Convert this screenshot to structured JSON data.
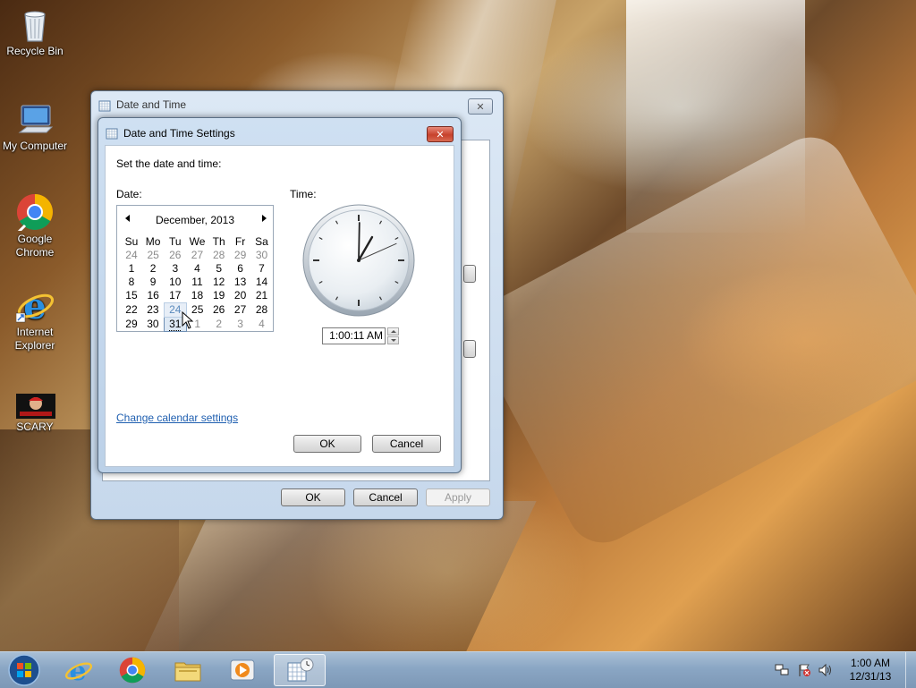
{
  "desktop": {
    "icons": [
      {
        "label": "Recycle Bin"
      },
      {
        "label": "My Computer"
      },
      {
        "label": "Google\nChrome"
      },
      {
        "label": "Internet\nExplorer"
      },
      {
        "label": "SCARY"
      }
    ]
  },
  "outer_window": {
    "title": "Date and Time",
    "ok_label": "OK",
    "cancel_label": "Cancel",
    "apply_label": "Apply"
  },
  "dialog": {
    "title": "Date and Time Settings",
    "instruction": "Set the date and time:",
    "date_label": "Date:",
    "time_label": "Time:",
    "calendar": {
      "month_year": "December, 2013",
      "weekdays": [
        "Su",
        "Mo",
        "Tu",
        "We",
        "Th",
        "Fr",
        "Sa"
      ],
      "weeks": [
        [
          "24",
          "25",
          "26",
          "27",
          "28",
          "29",
          "30"
        ],
        [
          "1",
          "2",
          "3",
          "4",
          "5",
          "6",
          "7"
        ],
        [
          "8",
          "9",
          "10",
          "11",
          "12",
          "13",
          "14"
        ],
        [
          "15",
          "16",
          "17",
          "18",
          "19",
          "20",
          "21"
        ],
        [
          "22",
          "23",
          "24",
          "25",
          "26",
          "27",
          "28"
        ],
        [
          "29",
          "30",
          "31",
          "1",
          "2",
          "3",
          "4"
        ]
      ]
    },
    "time_value": "1:00:11 AM",
    "clock_hour": 1,
    "clock_minute": 0,
    "clock_second": 11,
    "change_calendar_link": "Change calendar settings",
    "ok_label": "OK",
    "cancel_label": "Cancel"
  },
  "taskbar": {
    "clock_time": "1:00 AM",
    "clock_date": "12/31/13",
    "items": [
      "start-orb-icon",
      "internet-explorer-icon",
      "chrome-icon",
      "file-explorer-icon",
      "media-player-icon",
      "date-time-icon"
    ]
  },
  "colors": {
    "link": "#1f5fb0",
    "close_red": "#c7412c"
  }
}
